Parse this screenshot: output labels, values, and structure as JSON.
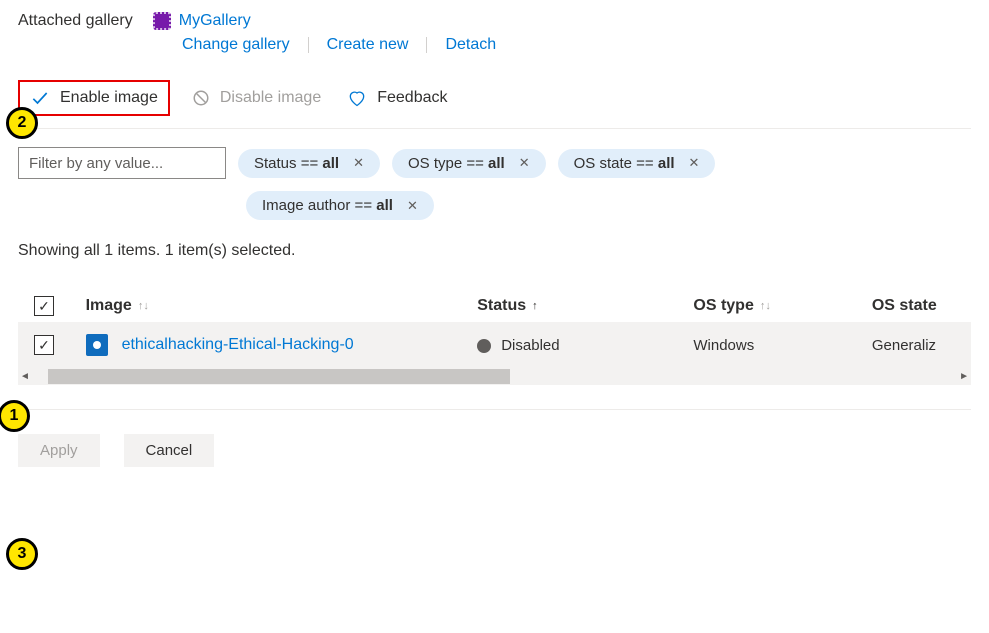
{
  "gallery": {
    "label": "Attached gallery",
    "name": "MyGallery",
    "change_label": "Change gallery",
    "create_label": "Create new",
    "detach_label": "Detach"
  },
  "toolbar": {
    "enable_label": "Enable image",
    "disable_label": "Disable image",
    "feedback_label": "Feedback"
  },
  "filters": {
    "placeholder": "Filter by any value...",
    "pills": [
      {
        "key": "Status",
        "value": "all"
      },
      {
        "key": "OS type",
        "value": "all"
      },
      {
        "key": "OS state",
        "value": "all"
      },
      {
        "key": "Image author",
        "value": "all"
      }
    ]
  },
  "status_line": "Showing all 1 items.   1 item(s) selected.",
  "table": {
    "headers": {
      "image": "Image",
      "status": "Status",
      "os_type": "OS type",
      "os_state": "OS state"
    },
    "row": {
      "image": "ethicalhacking-Ethical-Hacking-0",
      "status": "Disabled",
      "os_type": "Windows",
      "os_state": "Generaliz"
    }
  },
  "footer": {
    "apply": "Apply",
    "cancel": "Cancel"
  },
  "callouts": {
    "one": "1",
    "two": "2",
    "three": "3"
  }
}
